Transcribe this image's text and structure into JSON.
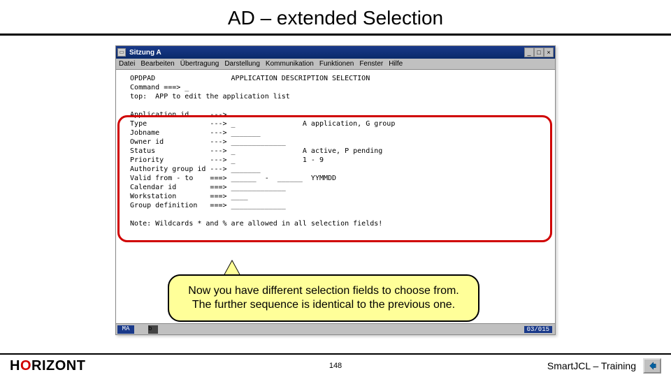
{
  "slide": {
    "title": "AD – extended Selection",
    "page_number": "148",
    "course_name": "SmartJCL – Training",
    "brand_h": "H",
    "brand_o": "O",
    "brand_rizont": "RIZONT"
  },
  "window": {
    "title": "Sitzung A",
    "menus": [
      "Datei",
      "Bearbeiten",
      "Übertragung",
      "Darstellung",
      "Kommunikation",
      "Funktionen",
      "Fenster",
      "Hilfe"
    ],
    "btn_min": "_",
    "btn_max": "□",
    "btn_close": "×",
    "status_left": "MA",
    "status_mid": "b",
    "status_right": "03/015"
  },
  "term": {
    "l1": "  OPDPAD                  APPLICATION DESCRIPTION SELECTION",
    "l2": "  Command ===> _",
    "l3": "",
    "l4": "  top:  APP to edit the application list",
    "l6": "  Application id     --->",
    "l7": "  Type               ---> _                A application, G group",
    "l8": "  Jobname            ---> _______",
    "l9": "  Owner id           ---> _____________",
    "l10": "  Status             ---> _                A active, P pending",
    "l11": "  Priority           ---> _                1 - 9",
    "l12": "  Authority group id ---> _______",
    "l13": "  Valid from - to    ===> ______  -  ______  YYMMDD",
    "l14": "  Calendar id        ===> _____________",
    "l15": "  Workstation        ===> ____",
    "l16": "  Group definition   ===> _____________",
    "l18": "  Note: Wildcards * and % are allowed in all selection fields!"
  },
  "callout": {
    "text": "Now you have different selection fields to choose from. The further sequence is identical to the previous one."
  },
  "icons": {
    "back_arrow": "back-arrow-icon"
  }
}
